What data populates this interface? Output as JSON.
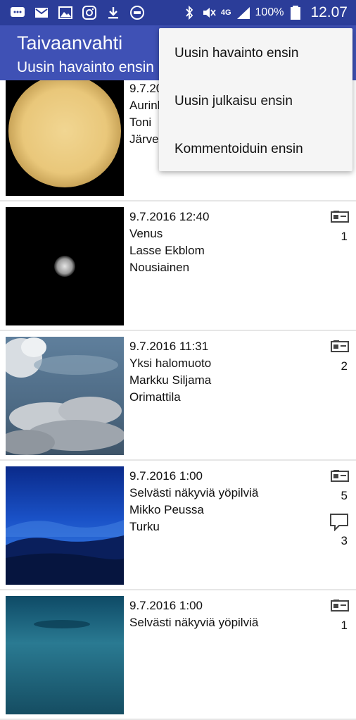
{
  "statusbar": {
    "signal_type": "4G",
    "battery": "100%",
    "time": "12.07"
  },
  "appbar": {
    "title": "Taivaanvahti",
    "subtitle": "Uusin havainto ensin"
  },
  "menu": {
    "items": [
      {
        "label": "Uusin havainto ensin"
      },
      {
        "label": "Uusin julkaisu ensin"
      },
      {
        "label": "Kommentoiduin ensin"
      }
    ]
  },
  "observations": [
    {
      "date": "9.7.2016",
      "title": "Aurinko",
      "observer": "Toni",
      "place": "Järvenpää",
      "photos": "",
      "comments": ""
    },
    {
      "date": "9.7.2016 12:40",
      "title": "Venus",
      "observer": "Lasse Ekblom",
      "place": "Nousiainen",
      "photos": "1",
      "comments": ""
    },
    {
      "date": "9.7.2016 11:31",
      "title": "Yksi halomuoto",
      "observer": "Markku Siljama",
      "place": "Orimattila",
      "photos": "2",
      "comments": ""
    },
    {
      "date": "9.7.2016 1:00",
      "title": "Selvästi näkyviä yöpilviä",
      "observer": "Mikko Peussa",
      "place": "Turku",
      "photos": "5",
      "comments": "3"
    },
    {
      "date": "9.7.2016 1:00",
      "title": "Selvästi näkyviä yöpilviä",
      "observer": "",
      "place": "",
      "photos": "1",
      "comments": ""
    }
  ],
  "icons": {
    "photo_count": "photo-card-icon",
    "comment_count": "comment-bubble-icon"
  },
  "colors": {
    "statusbar": "#2b3d99",
    "appbar": "#3f51b5",
    "menu_bg": "#f5f5f5"
  }
}
